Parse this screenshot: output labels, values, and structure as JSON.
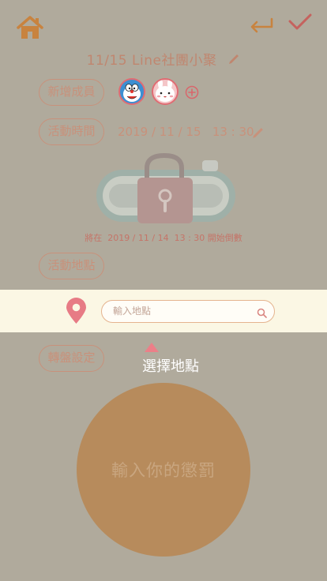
{
  "header": {
    "home_icon": "home-icon",
    "back_icon": "return-arrow-icon",
    "confirm_icon": "checkmark-icon",
    "title": "11/15 Line社團小聚"
  },
  "members": {
    "label": "新增成員",
    "avatars": [
      "doraemon-avatar",
      "cony-avatar"
    ],
    "add_icon": "plus-circle-icon"
  },
  "time": {
    "label": "活動時間",
    "value": "2019 / 11 / 15   13 : 30"
  },
  "lock": {
    "countdown": "將在  2019 / 11 / 14  13 : 30 開始倒數"
  },
  "location": {
    "label": "活動地點",
    "search_placeholder": "輸入地點",
    "hint": "選擇地點"
  },
  "wheel": {
    "label": "轉盤設定",
    "center_text": "輸入你的懲罰"
  },
  "colors": {
    "background": "#b0aa9c",
    "accent": "#c57a6c",
    "wheel": "#b78b5c",
    "strip": "#fbf7e4"
  }
}
